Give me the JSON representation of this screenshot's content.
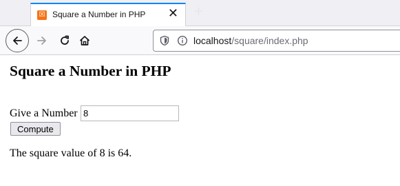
{
  "browser": {
    "tab": {
      "title": "Square a Number in PHP",
      "close_glyph": "✕",
      "favicon": "xampp-icon",
      "favicon_glyph": "☒"
    },
    "newtab_glyph": "+",
    "url": {
      "host": "localhost",
      "path": "/square/index.php"
    },
    "icons": [
      "back-arrow-icon",
      "forward-arrow-icon",
      "reload-icon",
      "home-icon",
      "shield-icon",
      "info-icon"
    ],
    "accent_color": "#0a84ff"
  },
  "page": {
    "title": "Square a Number in PHP",
    "form": {
      "label": "Give a Number",
      "input_value": "8",
      "button_label": "Compute"
    },
    "result": "The square value of 8 is 64."
  }
}
